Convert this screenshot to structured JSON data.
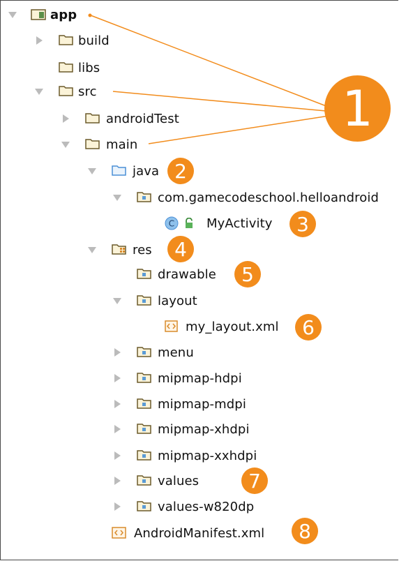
{
  "tree": {
    "app": "app",
    "build": "build",
    "libs": "libs",
    "src": "src",
    "androidTest": "androidTest",
    "main": "main",
    "java": "java",
    "package": "com.gamecodeschool.helloandroid",
    "activity": "MyActivity",
    "activity_icon_letter": "C",
    "res": "res",
    "drawable": "drawable",
    "layout": "layout",
    "layout_file": "my_layout.xml",
    "menu": "menu",
    "mipmap_hdpi": "mipmap-hdpi",
    "mipmap_mdpi": "mipmap-mdpi",
    "mipmap_xhdpi": "mipmap-xhdpi",
    "mipmap_xxhdpi": "mipmap-xxhdpi",
    "values": "values",
    "values_w820dp": "values-w820dp",
    "manifest": "AndroidManifest.xml"
  },
  "callouts": {
    "c1": "1",
    "c2": "2",
    "c3": "3",
    "c4": "4",
    "c5": "5",
    "c6": "6",
    "c7": "7",
    "c8": "8"
  },
  "colors": {
    "callout": "#f28c1c",
    "folder_outline": "#6b5a2a",
    "java_folder": "#4a8fd6",
    "class_icon": "#5b9bd5"
  },
  "icons": {
    "module": "module-folder-icon",
    "folder": "folder-icon",
    "source_folder": "source-folder-icon",
    "package": "package-folder-icon",
    "resource_folder": "resource-folder-icon",
    "class": "class-icon",
    "xml_file": "xml-file-icon",
    "expand": "expand-arrow-icon",
    "collapse": "collapse-arrow-icon"
  }
}
